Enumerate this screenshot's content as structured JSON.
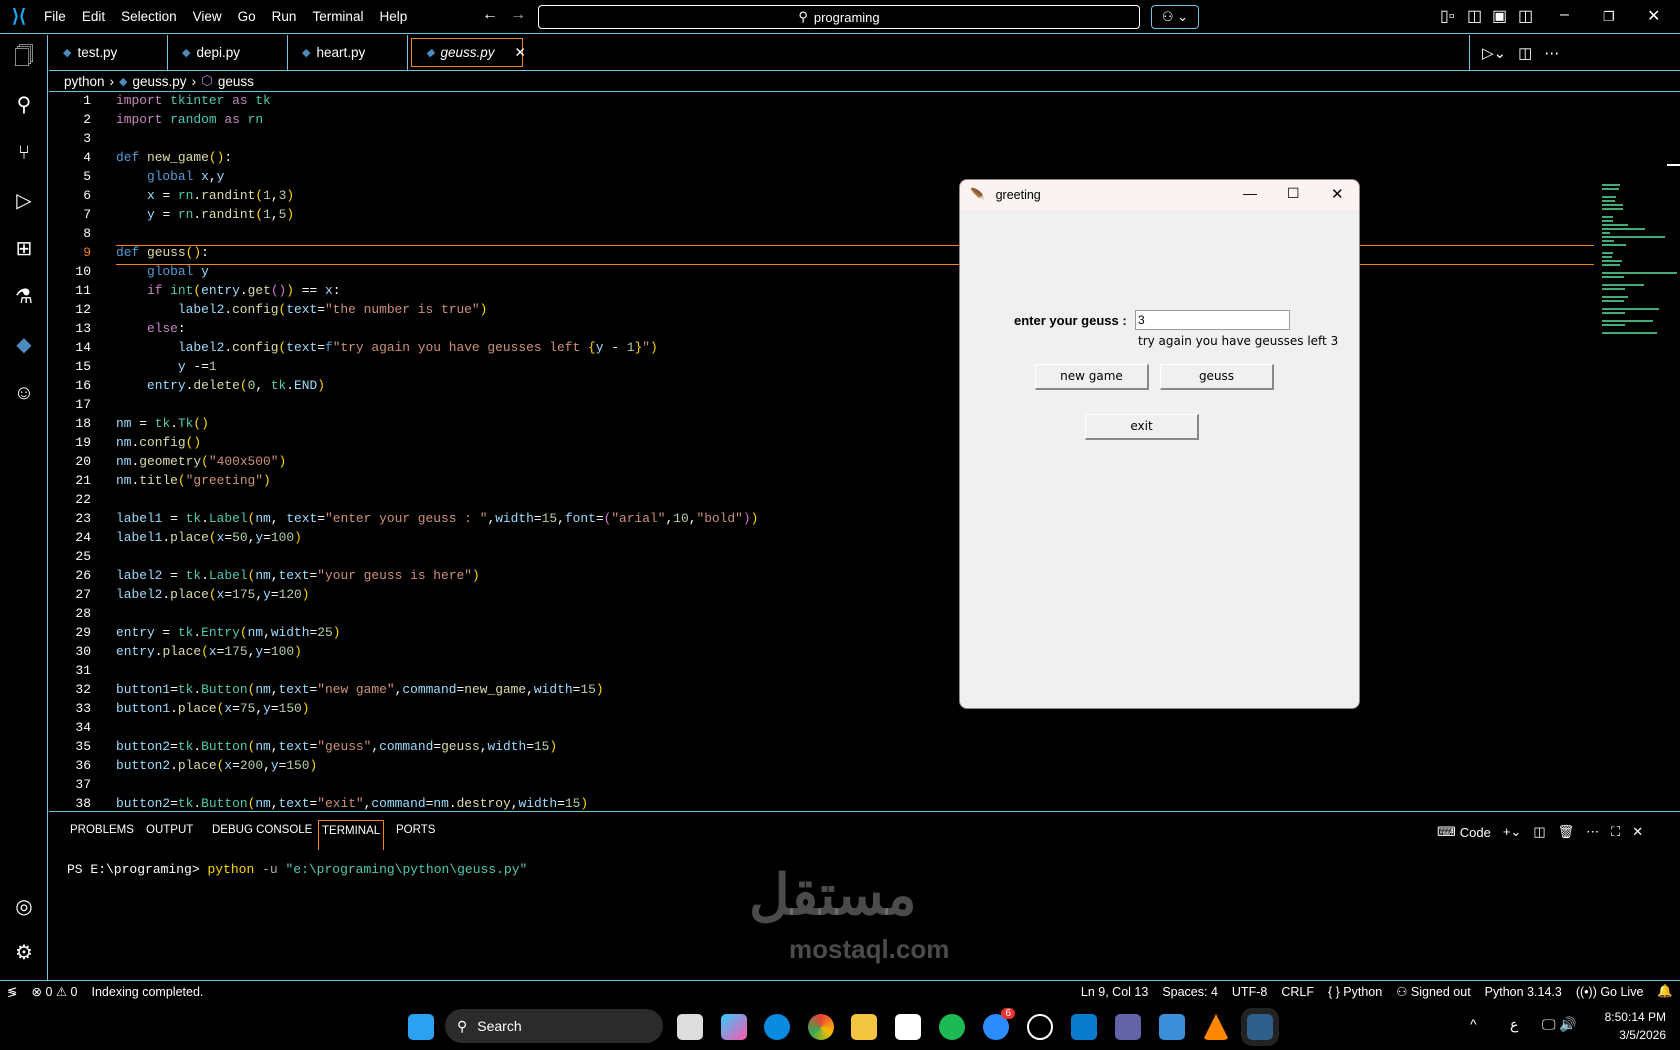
{
  "menu": [
    "File",
    "Edit",
    "Selection",
    "View",
    "Go",
    "Run",
    "Terminal",
    "Help"
  ],
  "search": "programing",
  "tabs": [
    {
      "label": "test.py"
    },
    {
      "label": "depi.py"
    },
    {
      "label": "heart.py"
    },
    {
      "label": "geuss.py"
    }
  ],
  "breadcrumb": [
    "python",
    "geuss.py",
    "geuss"
  ],
  "current_line": 9,
  "code": [
    [
      [
        "k",
        "import"
      ],
      [
        "p",
        " "
      ],
      [
        "m",
        "tkinter"
      ],
      [
        "p",
        " "
      ],
      [
        "k",
        "as"
      ],
      [
        "p",
        " "
      ],
      [
        "m",
        "tk"
      ]
    ],
    [
      [
        "k",
        "import"
      ],
      [
        "p",
        " "
      ],
      [
        "m",
        "random"
      ],
      [
        "p",
        " "
      ],
      [
        "k",
        "as"
      ],
      [
        "p",
        " "
      ],
      [
        "m",
        "rn"
      ]
    ],
    [],
    [
      [
        "d",
        "def"
      ],
      [
        "p",
        " "
      ],
      [
        "f",
        "new_game"
      ],
      [
        "y",
        "()"
      ],
      [
        "p",
        ":"
      ]
    ],
    [
      [
        "p",
        "    "
      ],
      [
        "d",
        "global"
      ],
      [
        "p",
        " "
      ],
      [
        "v",
        "x"
      ],
      [
        "p",
        ","
      ],
      [
        "v",
        "y"
      ]
    ],
    [
      [
        "p",
        "    "
      ],
      [
        "v",
        "x"
      ],
      [
        "p",
        " = "
      ],
      [
        "m",
        "rn"
      ],
      [
        "p",
        "."
      ],
      [
        "f",
        "randint"
      ],
      [
        "y",
        "("
      ],
      [
        "n",
        "1"
      ],
      [
        "p",
        ","
      ],
      [
        "n",
        "3"
      ],
      [
        "y",
        ")"
      ]
    ],
    [
      [
        "p",
        "    "
      ],
      [
        "v",
        "y"
      ],
      [
        "p",
        " = "
      ],
      [
        "m",
        "rn"
      ],
      [
        "p",
        "."
      ],
      [
        "f",
        "randint"
      ],
      [
        "y",
        "("
      ],
      [
        "n",
        "1"
      ],
      [
        "p",
        ","
      ],
      [
        "n",
        "5"
      ],
      [
        "y",
        ")"
      ]
    ],
    [],
    [
      [
        "d",
        "def"
      ],
      [
        "p",
        " "
      ],
      [
        "f",
        "geuss"
      ],
      [
        "y",
        "()"
      ],
      [
        "p",
        ":"
      ]
    ],
    [
      [
        "p",
        "    "
      ],
      [
        "d",
        "global"
      ],
      [
        "p",
        " "
      ],
      [
        "v",
        "y"
      ]
    ],
    [
      [
        "p",
        "    "
      ],
      [
        "k",
        "if"
      ],
      [
        "p",
        " "
      ],
      [
        "m",
        "int"
      ],
      [
        "y",
        "("
      ],
      [
        "v",
        "entry"
      ],
      [
        "p",
        "."
      ],
      [
        "f",
        "get"
      ],
      [
        "pk",
        "()"
      ],
      [
        "y",
        ")"
      ],
      [
        "p",
        " == "
      ],
      [
        "v",
        "x"
      ],
      [
        "p",
        ":"
      ]
    ],
    [
      [
        "p",
        "        "
      ],
      [
        "v",
        "label2"
      ],
      [
        "p",
        "."
      ],
      [
        "f",
        "config"
      ],
      [
        "y",
        "("
      ],
      [
        "v",
        "text"
      ],
      [
        "p",
        "="
      ],
      [
        "s",
        "\"the number is true\""
      ],
      [
        "y",
        ")"
      ]
    ],
    [
      [
        "p",
        "    "
      ],
      [
        "k",
        "else"
      ],
      [
        "p",
        ":"
      ]
    ],
    [
      [
        "p",
        "        "
      ],
      [
        "v",
        "label2"
      ],
      [
        "p",
        "."
      ],
      [
        "f",
        "config"
      ],
      [
        "y",
        "("
      ],
      [
        "v",
        "text"
      ],
      [
        "p",
        "="
      ],
      [
        "d",
        "f"
      ],
      [
        "s",
        "\"try again you have geusses left "
      ],
      [
        "y",
        "{"
      ],
      [
        "v",
        "y"
      ],
      [
        "p",
        " - "
      ],
      [
        "n",
        "1"
      ],
      [
        "y",
        "}"
      ],
      [
        "s",
        "\""
      ],
      [
        "y",
        ")"
      ]
    ],
    [
      [
        "p",
        "        "
      ],
      [
        "v",
        "y"
      ],
      [
        "p",
        " -="
      ],
      [
        "n",
        "1"
      ]
    ],
    [
      [
        "p",
        "    "
      ],
      [
        "v",
        "entry"
      ],
      [
        "p",
        "."
      ],
      [
        "f",
        "delete"
      ],
      [
        "y",
        "("
      ],
      [
        "n",
        "0"
      ],
      [
        "p",
        ", "
      ],
      [
        "m",
        "tk"
      ],
      [
        "p",
        "."
      ],
      [
        "v",
        "END"
      ],
      [
        "y",
        ")"
      ]
    ],
    [],
    [
      [
        "v",
        "nm"
      ],
      [
        "p",
        " = "
      ],
      [
        "m",
        "tk"
      ],
      [
        "p",
        "."
      ],
      [
        "m",
        "Tk"
      ],
      [
        "y",
        "()"
      ]
    ],
    [
      [
        "v",
        "nm"
      ],
      [
        "p",
        "."
      ],
      [
        "f",
        "config"
      ],
      [
        "y",
        "()"
      ]
    ],
    [
      [
        "v",
        "nm"
      ],
      [
        "p",
        "."
      ],
      [
        "f",
        "geometry"
      ],
      [
        "y",
        "("
      ],
      [
        "s",
        "\"400x500\""
      ],
      [
        "y",
        ")"
      ]
    ],
    [
      [
        "v",
        "nm"
      ],
      [
        "p",
        "."
      ],
      [
        "f",
        "title"
      ],
      [
        "y",
        "("
      ],
      [
        "s",
        "\"greeting\""
      ],
      [
        "y",
        ")"
      ]
    ],
    [],
    [
      [
        "v",
        "label1"
      ],
      [
        "p",
        " = "
      ],
      [
        "m",
        "tk"
      ],
      [
        "p",
        "."
      ],
      [
        "m",
        "Label"
      ],
      [
        "y",
        "("
      ],
      [
        "v",
        "nm"
      ],
      [
        "p",
        ", "
      ],
      [
        "v",
        "text"
      ],
      [
        "p",
        "="
      ],
      [
        "s",
        "\"enter your geuss : \""
      ],
      [
        "p",
        ","
      ],
      [
        "v",
        "width"
      ],
      [
        "p",
        "="
      ],
      [
        "n",
        "15"
      ],
      [
        "p",
        ","
      ],
      [
        "v",
        "font"
      ],
      [
        "p",
        "="
      ],
      [
        "pk",
        "("
      ],
      [
        "s",
        "\"arial\""
      ],
      [
        "p",
        ","
      ],
      [
        "n",
        "10"
      ],
      [
        "p",
        ","
      ],
      [
        "s",
        "\"bold\""
      ],
      [
        "pk",
        ")"
      ],
      [
        "y",
        ")"
      ]
    ],
    [
      [
        "v",
        "label1"
      ],
      [
        "p",
        "."
      ],
      [
        "f",
        "place"
      ],
      [
        "y",
        "("
      ],
      [
        "v",
        "x"
      ],
      [
        "p",
        "="
      ],
      [
        "n",
        "50"
      ],
      [
        "p",
        ","
      ],
      [
        "v",
        "y"
      ],
      [
        "p",
        "="
      ],
      [
        "n",
        "100"
      ],
      [
        "y",
        ")"
      ]
    ],
    [],
    [
      [
        "v",
        "label2"
      ],
      [
        "p",
        " = "
      ],
      [
        "m",
        "tk"
      ],
      [
        "p",
        "."
      ],
      [
        "m",
        "Label"
      ],
      [
        "y",
        "("
      ],
      [
        "v",
        "nm"
      ],
      [
        "p",
        ","
      ],
      [
        "v",
        "text"
      ],
      [
        "p",
        "="
      ],
      [
        "s",
        "\"your geuss is here\""
      ],
      [
        "y",
        ")"
      ]
    ],
    [
      [
        "v",
        "label2"
      ],
      [
        "p",
        "."
      ],
      [
        "f",
        "place"
      ],
      [
        "y",
        "("
      ],
      [
        "v",
        "x"
      ],
      [
        "p",
        "="
      ],
      [
        "n",
        "175"
      ],
      [
        "p",
        ","
      ],
      [
        "v",
        "y"
      ],
      [
        "p",
        "="
      ],
      [
        "n",
        "120"
      ],
      [
        "y",
        ")"
      ]
    ],
    [],
    [
      [
        "v",
        "entry"
      ],
      [
        "p",
        " = "
      ],
      [
        "m",
        "tk"
      ],
      [
        "p",
        "."
      ],
      [
        "m",
        "Entry"
      ],
      [
        "y",
        "("
      ],
      [
        "v",
        "nm"
      ],
      [
        "p",
        ","
      ],
      [
        "v",
        "width"
      ],
      [
        "p",
        "="
      ],
      [
        "n",
        "25"
      ],
      [
        "y",
        ")"
      ]
    ],
    [
      [
        "v",
        "entry"
      ],
      [
        "p",
        "."
      ],
      [
        "f",
        "place"
      ],
      [
        "y",
        "("
      ],
      [
        "v",
        "x"
      ],
      [
        "p",
        "="
      ],
      [
        "n",
        "175"
      ],
      [
        "p",
        ","
      ],
      [
        "v",
        "y"
      ],
      [
        "p",
        "="
      ],
      [
        "n",
        "100"
      ],
      [
        "y",
        ")"
      ]
    ],
    [],
    [
      [
        "v",
        "button1"
      ],
      [
        "p",
        "="
      ],
      [
        "m",
        "tk"
      ],
      [
        "p",
        "."
      ],
      [
        "m",
        "Button"
      ],
      [
        "y",
        "("
      ],
      [
        "v",
        "nm"
      ],
      [
        "p",
        ","
      ],
      [
        "v",
        "text"
      ],
      [
        "p",
        "="
      ],
      [
        "s",
        "\"new game\""
      ],
      [
        "p",
        ","
      ],
      [
        "v",
        "command"
      ],
      [
        "p",
        "="
      ],
      [
        "f",
        "new_game"
      ],
      [
        "p",
        ","
      ],
      [
        "v",
        "width"
      ],
      [
        "p",
        "="
      ],
      [
        "n",
        "15"
      ],
      [
        "y",
        ")"
      ]
    ],
    [
      [
        "v",
        "button1"
      ],
      [
        "p",
        "."
      ],
      [
        "f",
        "place"
      ],
      [
        "y",
        "("
      ],
      [
        "v",
        "x"
      ],
      [
        "p",
        "="
      ],
      [
        "n",
        "75"
      ],
      [
        "p",
        ","
      ],
      [
        "v",
        "y"
      ],
      [
        "p",
        "="
      ],
      [
        "n",
        "150"
      ],
      [
        "y",
        ")"
      ]
    ],
    [],
    [
      [
        "v",
        "button2"
      ],
      [
        "p",
        "="
      ],
      [
        "m",
        "tk"
      ],
      [
        "p",
        "."
      ],
      [
        "m",
        "Button"
      ],
      [
        "y",
        "("
      ],
      [
        "v",
        "nm"
      ],
      [
        "p",
        ","
      ],
      [
        "v",
        "text"
      ],
      [
        "p",
        "="
      ],
      [
        "s",
        "\"geuss\""
      ],
      [
        "p",
        ","
      ],
      [
        "v",
        "command"
      ],
      [
        "p",
        "="
      ],
      [
        "f",
        "geuss"
      ],
      [
        "p",
        ","
      ],
      [
        "v",
        "width"
      ],
      [
        "p",
        "="
      ],
      [
        "n",
        "15"
      ],
      [
        "y",
        ")"
      ]
    ],
    [
      [
        "v",
        "button2"
      ],
      [
        "p",
        "."
      ],
      [
        "f",
        "place"
      ],
      [
        "y",
        "("
      ],
      [
        "v",
        "x"
      ],
      [
        "p",
        "="
      ],
      [
        "n",
        "200"
      ],
      [
        "p",
        ","
      ],
      [
        "v",
        "y"
      ],
      [
        "p",
        "="
      ],
      [
        "n",
        "150"
      ],
      [
        "y",
        ")"
      ]
    ],
    [],
    [
      [
        "v",
        "button2"
      ],
      [
        "p",
        "="
      ],
      [
        "m",
        "tk"
      ],
      [
        "p",
        "."
      ],
      [
        "m",
        "Button"
      ],
      [
        "y",
        "("
      ],
      [
        "v",
        "nm"
      ],
      [
        "p",
        ","
      ],
      [
        "v",
        "text"
      ],
      [
        "p",
        "="
      ],
      [
        "s",
        "\"exit\""
      ],
      [
        "p",
        ","
      ],
      [
        "v",
        "command"
      ],
      [
        "p",
        "="
      ],
      [
        "v",
        "nm"
      ],
      [
        "p",
        "."
      ],
      [
        "f",
        "destroy"
      ],
      [
        "p",
        ","
      ],
      [
        "v",
        "width"
      ],
      [
        "p",
        "="
      ],
      [
        "n",
        "15"
      ],
      [
        "y",
        ")"
      ]
    ]
  ],
  "panel": {
    "tabs": [
      "PROBLEMS",
      "OUTPUT",
      "DEBUG CONSOLE",
      "TERMINAL",
      "PORTS"
    ],
    "shell": "Code",
    "terminal": {
      "prompt": "PS E:\\programing> ",
      "cmd": "python",
      "flag": " -u ",
      "arg": "\"e:\\programing\\python\\geuss.py\""
    }
  },
  "status": {
    "errors": "0",
    "warnings": "0",
    "message": "Indexing completed.",
    "position": "Ln 9, Col 13",
    "spaces": "Spaces: 4",
    "encoding": "UTF-8",
    "eol": "CRLF",
    "language": "Python",
    "account": "Signed out",
    "interpreter": "Python 3.14.3",
    "golive": "Go Live"
  },
  "tkwindow": {
    "title": "greeting",
    "label1": "enter your geuss :",
    "entry_value": "3",
    "label2": "try again you have geusses left 3",
    "btn_new": "new game",
    "btn_geuss": "geuss",
    "btn_exit": "exit"
  },
  "taskbar": {
    "search": "Search",
    "time": "8:50:14 PM",
    "date": "3/5/2026",
    "badge_zm": "6",
    "lang": "ع"
  },
  "watermark": "mostaql.com"
}
